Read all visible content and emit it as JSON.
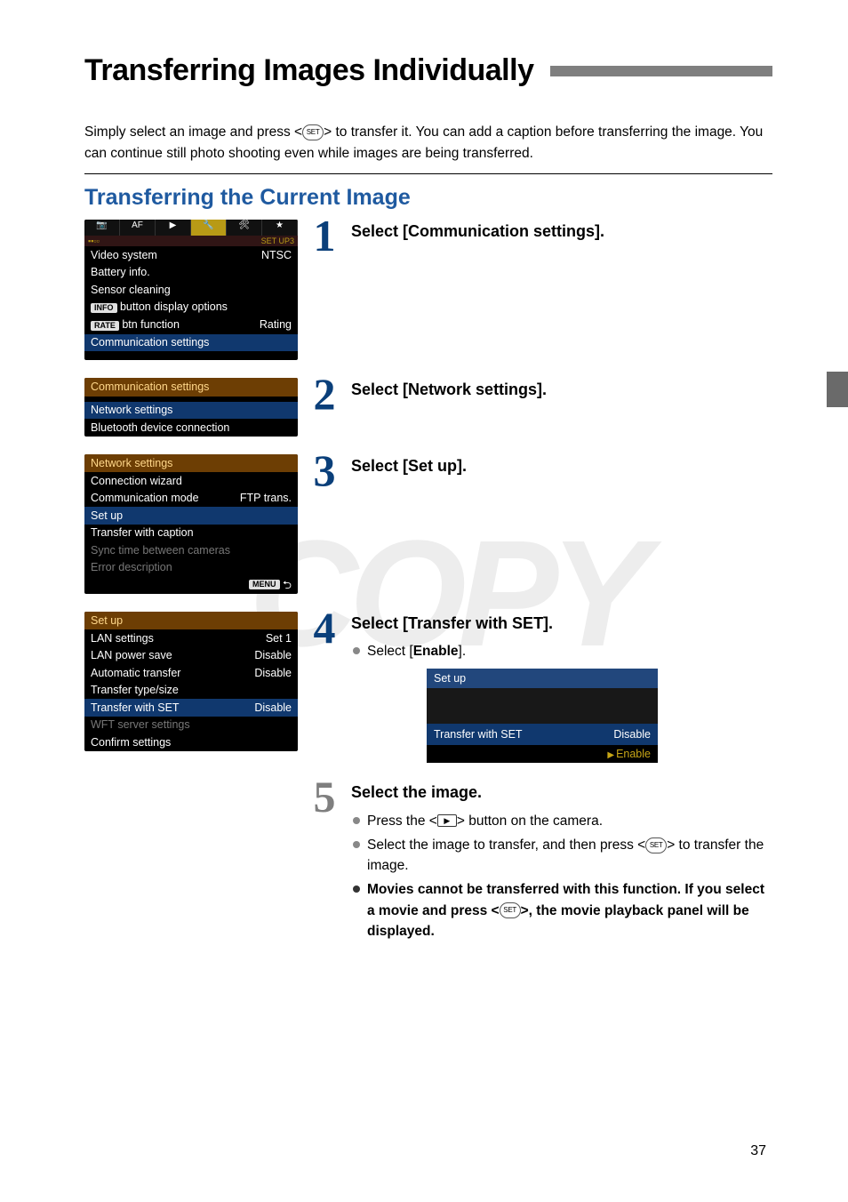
{
  "title": "Transferring Images Individually",
  "intro": {
    "part1": "Simply select an image and press <",
    "set": "SET",
    "part2": "> to transfer it. You can add a caption before transferring the image. You can continue still photo shooting even while images are being transferred."
  },
  "section_title": "Transferring the Current Image",
  "watermark": "COPY",
  "page_number": "37",
  "steps": {
    "s1": {
      "num": "1",
      "head": "Select [Communication settings]."
    },
    "s2": {
      "num": "2",
      "head": "Select [Network settings]."
    },
    "s3": {
      "num": "3",
      "head": "Select [Set up]."
    },
    "s4": {
      "num": "4",
      "head": "Select [Transfer with SET].",
      "bullet1_pre": "Select [",
      "bullet1_strong": "Enable",
      "bullet1_post": "]."
    },
    "s5": {
      "num": "5",
      "head": "Select the image.",
      "b1_pre": "Press the <",
      "b1_post": "> button on the camera.",
      "b2_pre": "Select the image to transfer, and then press <",
      "b2_post": "> to transfer the image.",
      "b3": "Movies cannot be transferred with this function. If you select a movie and press <",
      "b3_post": ">, the movie playback panel will be displayed."
    }
  },
  "screens": {
    "setup3": {
      "tab_setup3": "SET UP3",
      "rows": {
        "video_system": "Video system",
        "video_system_val": "NTSC",
        "battery": "Battery info.",
        "sensor": "Sensor cleaning",
        "info_btn": " button display options",
        "info_badge": "INFO",
        "rate_btn": " btn function",
        "rate_badge": "RATE",
        "rate_val": "Rating",
        "comm": "Communication settings"
      }
    },
    "comm": {
      "title": "Communication settings",
      "r1": "Network settings",
      "r2": "Bluetooth device connection"
    },
    "net": {
      "title": "Network settings",
      "r1": "Connection wizard",
      "r2": "Communication mode",
      "r2v": "FTP trans.",
      "r3": "Set up",
      "r4": "Transfer with caption",
      "r5": "Sync time between cameras",
      "r6": "Error description",
      "menu": "MENU",
      "back_sym": "⮌"
    },
    "setup": {
      "title": "Set up",
      "r1": "LAN settings",
      "r1v": "Set 1",
      "r2": "LAN power save",
      "r2v": "Disable",
      "r3": "Automatic transfer",
      "r3v": "Disable",
      "r4": "Transfer type/size",
      "r5": "Transfer with SET",
      "r5v": "Disable",
      "r6": "WFT server settings",
      "r7": "Confirm settings"
    },
    "sub": {
      "title": "Set up",
      "row_label": "Transfer with SET",
      "row_val": "Disable",
      "enable": "Enable"
    }
  }
}
